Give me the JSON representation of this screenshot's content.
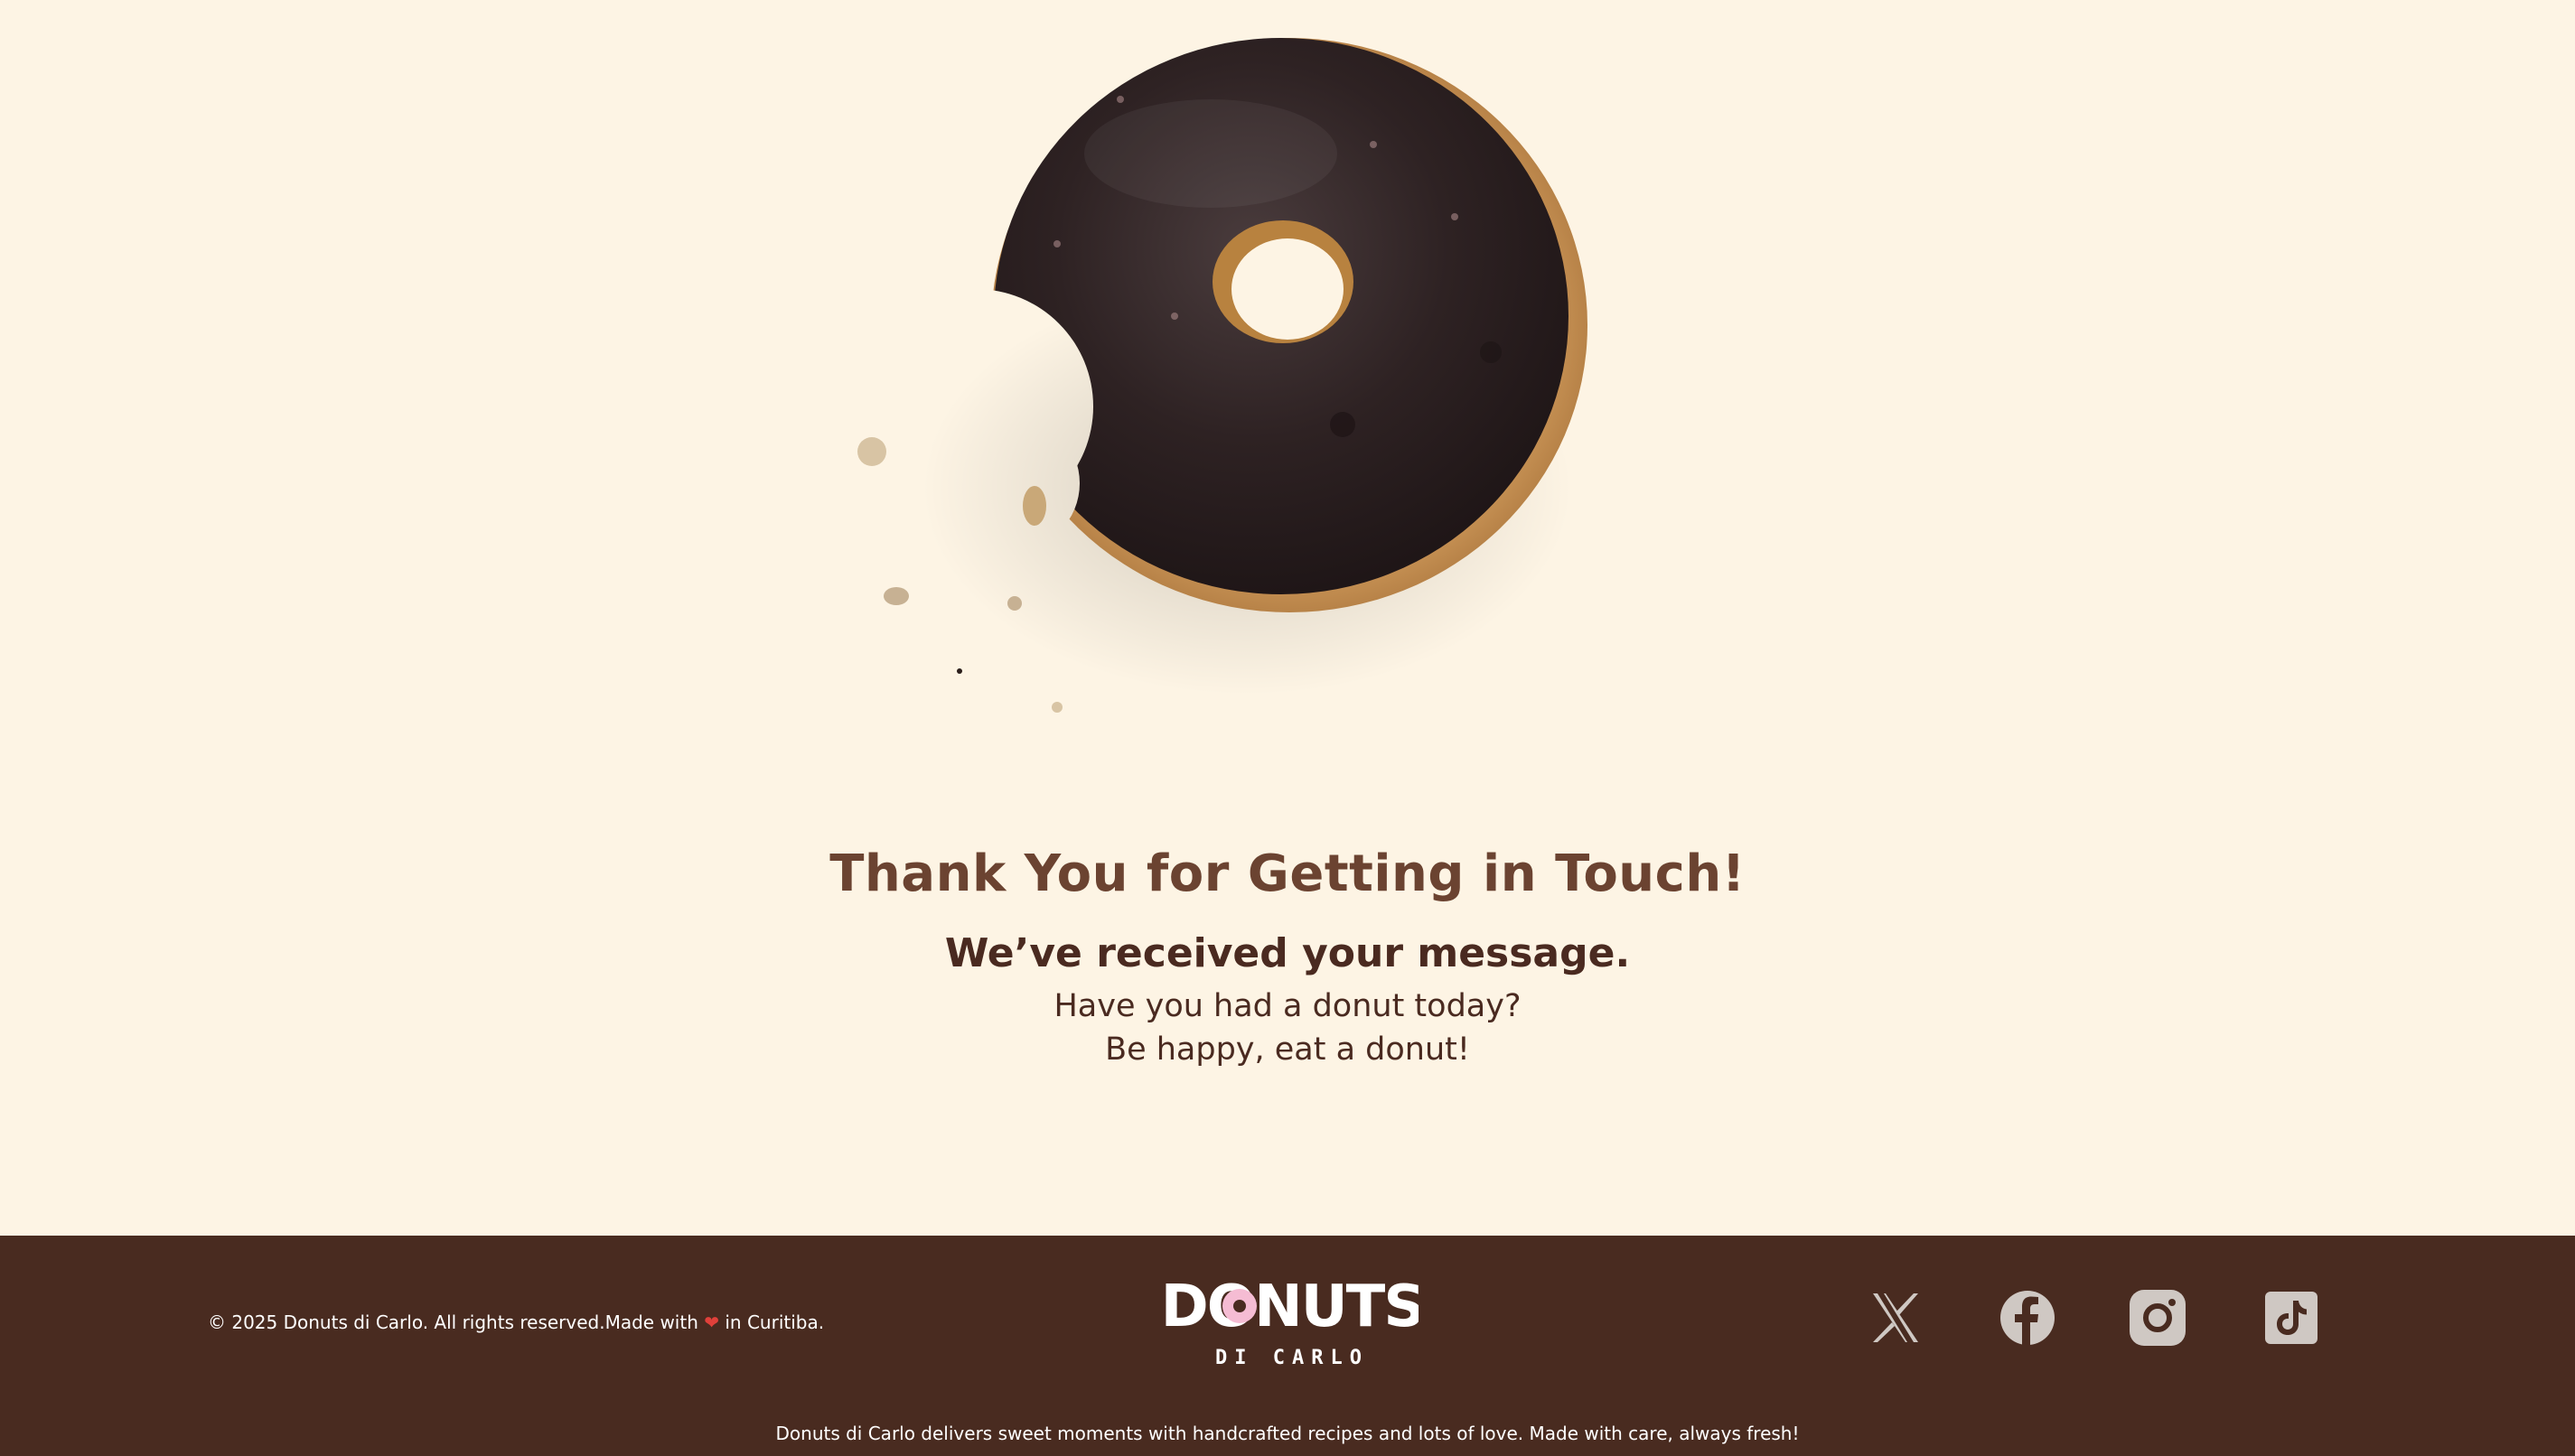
{
  "hero": {
    "heading": "Thank You for Getting in Touch!",
    "subheading": "We’ve received your message.",
    "line1": "Have you had a donut today?",
    "line2": "Be happy, eat a donut!"
  },
  "footer": {
    "copyright_prefix": "© 2025 Donuts di Carlo. All rights reserved.Made with",
    "copyright_suffix": "in Curitiba.",
    "heart": "❤",
    "logo_main": "DONUTS",
    "logo_sub": "DI CARLO",
    "tagline": "Donuts di Carlo delivers sweet moments with handcrafted recipes and lots of love. Made with care, always fresh!",
    "socials": [
      "x-icon",
      "facebook-icon",
      "instagram-icon",
      "tiktok-icon"
    ]
  },
  "colors": {
    "background": "#fdf4e4",
    "heading": "#6b4331",
    "text": "#4a2a20",
    "footer": "#492b20",
    "social_icon": "#cfc8c3"
  }
}
